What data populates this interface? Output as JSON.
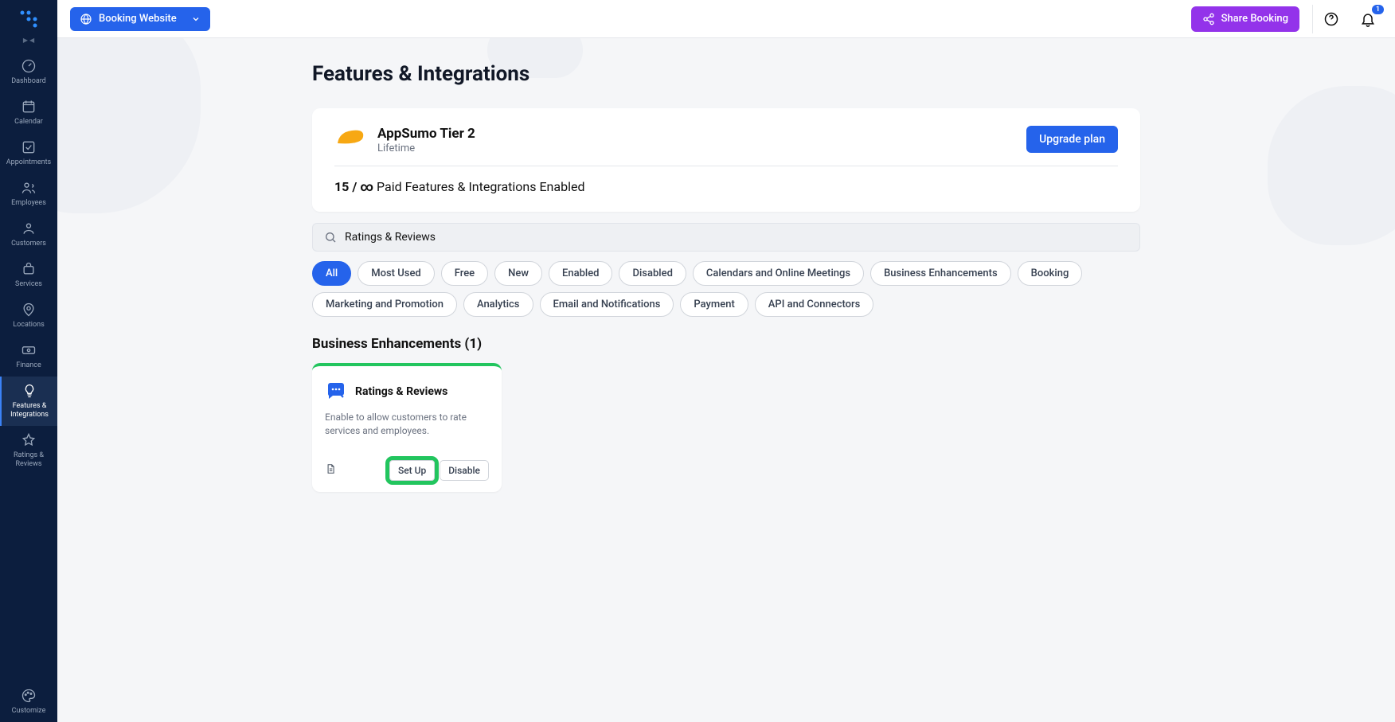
{
  "topbar": {
    "context_label": "Booking Website",
    "share_label": "Share Booking",
    "notification_count": "1"
  },
  "sidebar": {
    "items": [
      {
        "label": "Dashboard"
      },
      {
        "label": "Calendar"
      },
      {
        "label": "Appointments"
      },
      {
        "label": "Employees"
      },
      {
        "label": "Customers"
      },
      {
        "label": "Services"
      },
      {
        "label": "Locations"
      },
      {
        "label": "Finance"
      },
      {
        "label": "Features & Integrations"
      },
      {
        "label": "Ratings & Reviews"
      }
    ],
    "footer_label": "Customize"
  },
  "page_title": "Features & Integrations",
  "plan": {
    "name": "AppSumo Tier 2",
    "term": "Lifetime",
    "upgrade_label": "Upgrade plan",
    "usage_count": "15 / ∞",
    "usage_suffix": " Paid Features & Integrations Enabled"
  },
  "search": {
    "value": "Ratings & Reviews"
  },
  "filters": [
    "All",
    "Most Used",
    "Free",
    "New",
    "Enabled",
    "Disabled",
    "Calendars and Online Meetings",
    "Business Enhancements",
    "Booking",
    "Marketing and Promotion",
    "Analytics",
    "Email and Notifications",
    "Payment",
    "API and Connectors"
  ],
  "active_filter_index": 0,
  "section": {
    "title": "Business Enhancements (1)",
    "card": {
      "name": "Ratings & Reviews",
      "desc": "Enable to allow customers to rate services and employees.",
      "setup_label": "Set Up",
      "disable_label": "Disable"
    }
  }
}
